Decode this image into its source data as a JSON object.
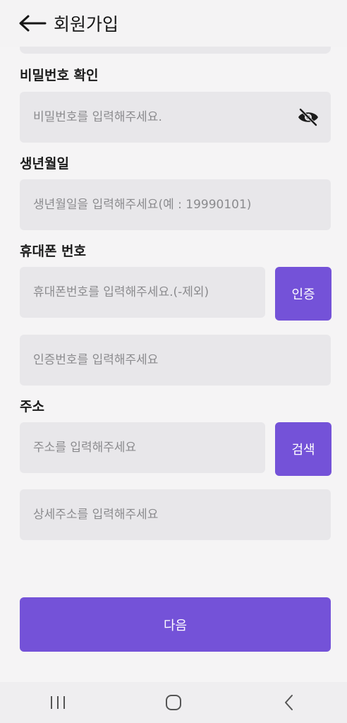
{
  "header": {
    "title": "회원가입",
    "back_icon": "arrow-left-icon"
  },
  "password_confirm": {
    "label": "비밀번호 확인",
    "placeholder": "비밀번호를 입력해주세요.",
    "toggle_icon": "eye-off-icon"
  },
  "birthdate": {
    "label": "생년월일",
    "placeholder": "생년월일을 입력해주세요(예 : 19990101)"
  },
  "phone": {
    "label": "휴대폰 번호",
    "placeholder": "휴대폰번호를 입력해주세요.(-제외)",
    "verify_button": "인증",
    "code_placeholder": "인증번호를 입력해주세요"
  },
  "address": {
    "label": "주소",
    "placeholder": "주소를 입력해주세요",
    "search_button": "검색",
    "detail_placeholder": "상세주소를 입력해주세요"
  },
  "next_button": "다음",
  "navbar": {
    "items": [
      "recent-apps-icon",
      "home-icon",
      "back-icon"
    ]
  },
  "colors": {
    "accent": "#7452d8",
    "field_bg": "#e8e7ea",
    "page_bg": "#f5f4f5"
  }
}
